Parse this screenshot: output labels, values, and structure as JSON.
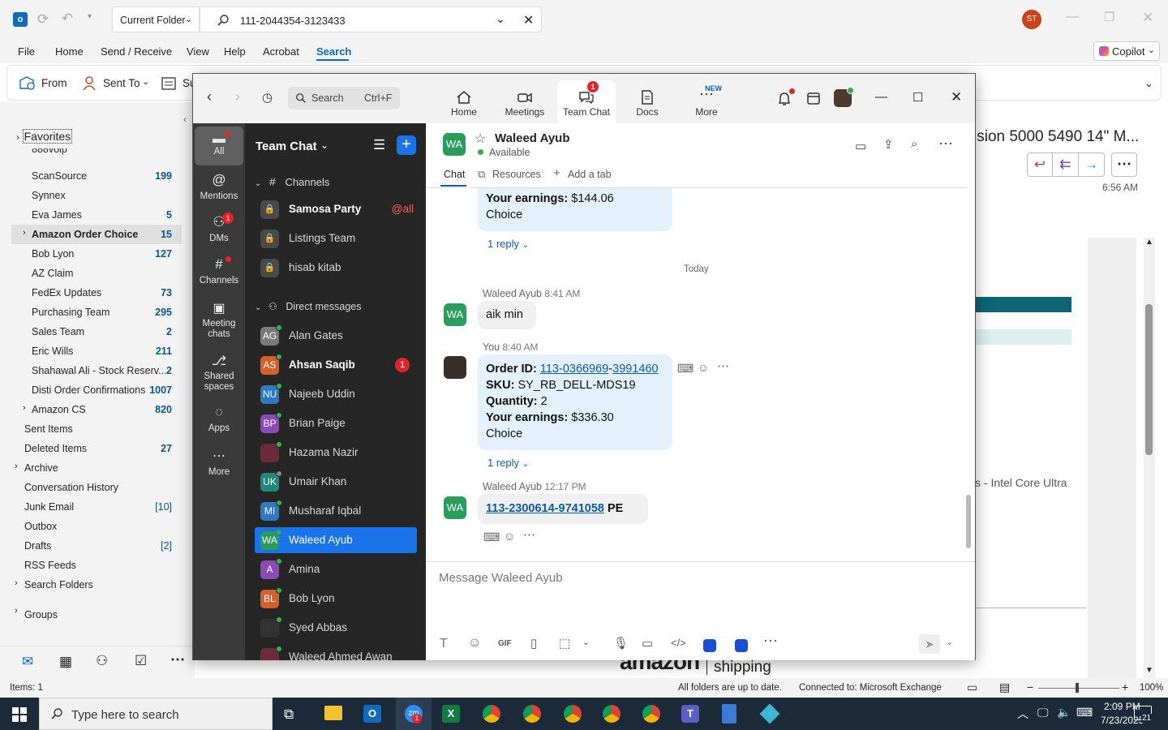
{
  "outlook": {
    "search_scope": "Current Folder",
    "search_query": "111-2044354-3123433",
    "user_initials": "ST",
    "menu": [
      "File",
      "Home",
      "Send / Receive",
      "View",
      "Help",
      "Acrobat",
      "Search"
    ],
    "copilot_label": "Copilot",
    "ribbon": {
      "from": "From",
      "sent_to": "Sent To",
      "subject_partial": "Su"
    },
    "favorites_label": "Favorites",
    "folders": [
      {
        "name": "888voip",
        "count": ""
      },
      {
        "name": "ScanSource",
        "count": "199"
      },
      {
        "name": "Synnex",
        "count": ""
      },
      {
        "name": "Eva James",
        "count": "5"
      },
      {
        "name": "Amazon Order Choice",
        "count": "15"
      },
      {
        "name": "Bob Lyon",
        "count": "127"
      },
      {
        "name": "AZ Claim",
        "count": ""
      },
      {
        "name": "FedEx Updates",
        "count": "73"
      },
      {
        "name": "Purchasing Team",
        "count": "295"
      },
      {
        "name": "Sales Team",
        "count": "2"
      },
      {
        "name": "Eric Wills",
        "count": "211"
      },
      {
        "name": "Shahawal Ali - Stock Reserv...",
        "count": "2"
      },
      {
        "name": "Disti Order Confirmations",
        "count": "1007"
      },
      {
        "name": "Amazon CS",
        "count": "820"
      },
      {
        "name": "Sent Items",
        "count": ""
      },
      {
        "name": "Deleted Items",
        "count": "27"
      },
      {
        "name": "Archive",
        "count": ""
      },
      {
        "name": "Conversation History",
        "count": ""
      },
      {
        "name": "Junk Email",
        "count": "[10]"
      },
      {
        "name": "Outbox",
        "count": ""
      },
      {
        "name": "Drafts",
        "count": "[2]"
      },
      {
        "name": "RSS Feeds",
        "count": ""
      },
      {
        "name": "Search Folders",
        "count": ""
      },
      {
        "name": "Groups",
        "count": ""
      }
    ],
    "reading": {
      "subject_partial": "ision 5000 5490 14\" M...",
      "time": "6:56 AM",
      "body_partial": "s - Intel Core Ultra",
      "footer_brand": "amazon",
      "footer_word": "shipping"
    },
    "status": {
      "items": "Items: 1",
      "sync": "All folders are up to date.",
      "connection": "Connected to: Microsoft Exchange",
      "zoom": "100%"
    }
  },
  "zoom": {
    "search_placeholder": "Search",
    "search_shortcut": "Ctrl+F",
    "tabs": [
      {
        "label": "Home"
      },
      {
        "label": "Meetings"
      },
      {
        "label": "Team Chat",
        "badge": "1"
      },
      {
        "label": "Docs"
      },
      {
        "label": "More",
        "badge": "NEW"
      }
    ],
    "rail": [
      {
        "label": "All"
      },
      {
        "label": "Mentions"
      },
      {
        "label": "DMs",
        "badge": "1"
      },
      {
        "label": "Channels"
      },
      {
        "label": "Meeting chats"
      },
      {
        "label": "Shared spaces"
      },
      {
        "label": "Apps"
      },
      {
        "label": "More"
      }
    ],
    "list_title": "Team Chat",
    "channels_header": "Channels",
    "channels": [
      {
        "name": "Samosa Party",
        "tag": "@all"
      },
      {
        "name": "Listings Team",
        "tag": ""
      },
      {
        "name": "hisab kitab",
        "tag": ""
      }
    ],
    "dm_header": "Direct messages",
    "dms": [
      {
        "initials": "AG",
        "name": "Alan Gates",
        "color": "#7a7a7a"
      },
      {
        "initials": "AS",
        "name": "Ahsan Saqib",
        "color": "#d4602a",
        "badge": "1"
      },
      {
        "initials": "NU",
        "name": "Najeeb Uddin",
        "color": "#2f78c4"
      },
      {
        "initials": "BP",
        "name": "Brian Paige",
        "color": "#8a4bb8"
      },
      {
        "initials": "",
        "name": "Hazama Nazir",
        "color": "#6b2b3a"
      },
      {
        "initials": "UK",
        "name": "Umair Khan",
        "color": "#1f8a7a"
      },
      {
        "initials": "MI",
        "name": "Musharaf Iqbal",
        "color": "#2f78c4"
      },
      {
        "initials": "WA",
        "name": "Waleed Ayub",
        "color": "#2a9d5c"
      },
      {
        "initials": "A",
        "name": "Amina",
        "color": "#8a4bb8"
      },
      {
        "initials": "BL",
        "name": "Bob Lyon",
        "color": "#d4602a"
      },
      {
        "initials": "",
        "name": "Syed Abbas",
        "color": "#333"
      },
      {
        "initials": "",
        "name": "Waleed Ahmed Awan",
        "color": "#6b2b3a"
      }
    ],
    "chat": {
      "contact_initials": "WA",
      "contact_name": "Waleed Ayub",
      "presence": "Available",
      "tabs": [
        "Chat",
        "Resources",
        "Add a tab"
      ],
      "prev_earnings_label": "Your earnings:",
      "prev_earnings_value": "$144.06",
      "prev_choice": "Choice",
      "reply_label": "1 reply",
      "date_divider": "Today",
      "m1_sender": "Waleed Ayub",
      "m1_time": "8:41 AM",
      "m1_text": "aik min",
      "m2_sender": "You",
      "m2_time": "8:40 AM",
      "order_label": "Order ID:",
      "order_part1": "113-0366969",
      "order_sep": "-",
      "order_part2": "3991460",
      "sku_label": "SKU:",
      "sku_value": "SY_RB_DELL-MDS19",
      "qty_label": "Quantity:",
      "qty_value": "2",
      "earn_label": "Your earnings:",
      "earn_value": "$336.30",
      "choice": "Choice",
      "m3_sender": "Waleed Ayub",
      "m3_time": "12:17 PM",
      "m3_link": "113-2300614-9741058",
      "m3_suffix": "PE",
      "composer_placeholder": "Message Waleed Ayub"
    }
  },
  "taskbar": {
    "search_placeholder": "Type here to search",
    "time": "2:09 PM",
    "date": "7/23/2025",
    "notifications": "21"
  }
}
